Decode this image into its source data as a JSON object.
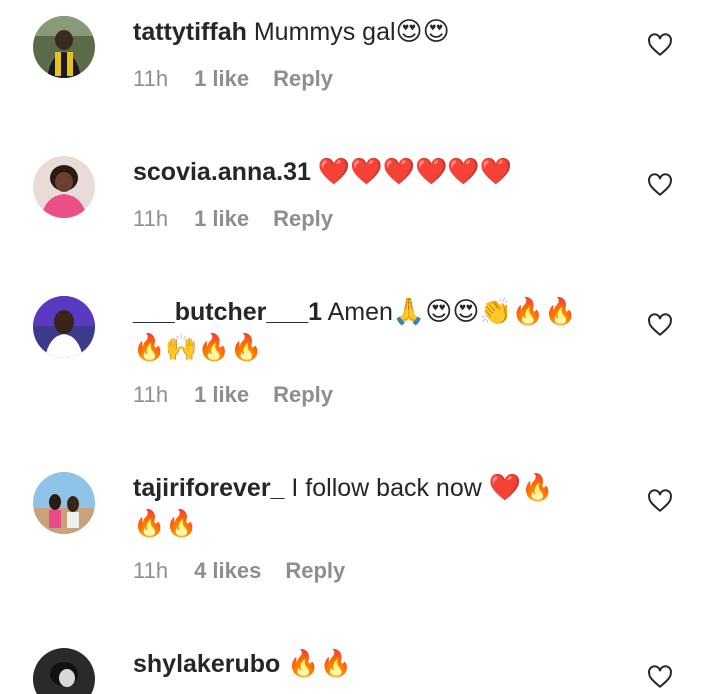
{
  "comments": [
    {
      "username": "tattytiffah",
      "text": " Mummys gal",
      "emoji": "😍😍",
      "time": "11h",
      "likes": "1 like",
      "reply": "Reply"
    },
    {
      "username": "scovia.anna.31",
      "text": " ",
      "emoji": "❤️❤️❤️❤️❤️❤️",
      "time": "11h",
      "likes": "1 like",
      "reply": "Reply"
    },
    {
      "username": "___butcher___1",
      "text": " Amen",
      "emoji": "🙏😍😍👏🔥🔥",
      "emoji_line2": "🔥🙌🔥🔥",
      "time": "11h",
      "likes": "1 like",
      "reply": "Reply"
    },
    {
      "username": "tajiriforever_",
      "text": " I follow back now ",
      "emoji": "❤️🔥",
      "emoji_line2": "🔥🔥",
      "time": "11h",
      "likes": "4 likes",
      "reply": "Reply"
    },
    {
      "username": "shylakerubo",
      "text": " ",
      "emoji": "🔥🔥"
    }
  ],
  "icons": {
    "like": "heart-outline-icon"
  },
  "colors": {
    "text": "#262626",
    "meta": "#8e8e8e",
    "background": "#ffffff"
  }
}
